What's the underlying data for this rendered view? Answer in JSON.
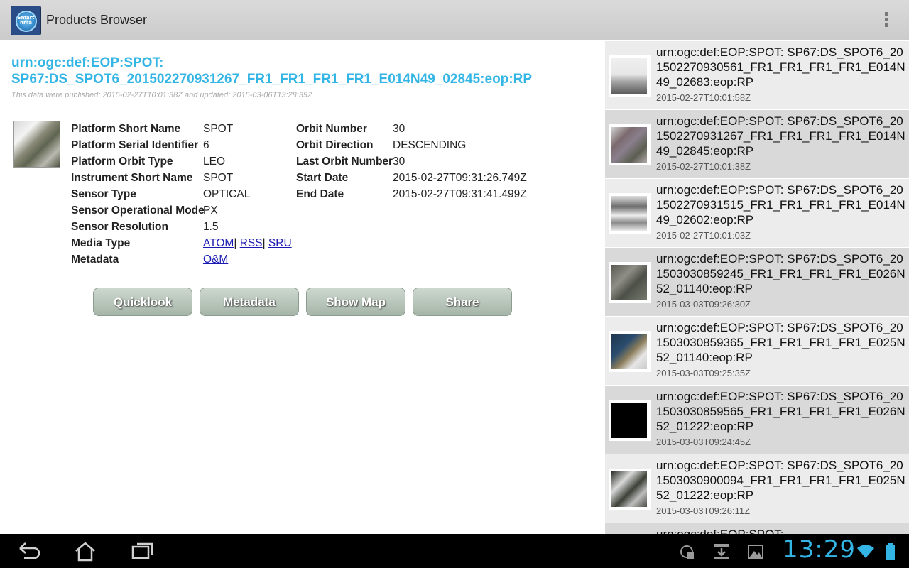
{
  "app": {
    "title": "Products Browser",
    "icon_text_1": "Smart",
    "icon_text_2": "hma",
    "menu_icon": "overflow-menu-icon"
  },
  "detail": {
    "title": "urn:ogc:def:EOP:SPOT: SP67:DS_SPOT6_201502270931267_FR1_FR1_FR1_FR1_E014N49_02845:eop:RP",
    "published": "This data were published: 2015-02-27T10:01:38Z and updated: 2015-03-06T13:28:39Z",
    "left_props": [
      {
        "label": "Platform Short Name",
        "value": "SPOT"
      },
      {
        "label": "Platform Serial Identifier",
        "value": "6"
      },
      {
        "label": "Platform Orbit Type",
        "value": "LEO"
      },
      {
        "label": "Instrument Short Name",
        "value": "SPOT"
      },
      {
        "label": "Sensor Type",
        "value": "OPTICAL"
      },
      {
        "label": "Sensor Operational Mode",
        "value": "PX"
      },
      {
        "label": "Sensor Resolution",
        "value": "1.5"
      },
      {
        "label": "Media Type",
        "value": ""
      },
      {
        "label": "Metadata",
        "value": ""
      }
    ],
    "media_links": {
      "atom": "ATOM",
      "sep1": "|",
      "rss": "RSS",
      "sep2": "|",
      "sru": "SRU"
    },
    "metadata_link": "O&M",
    "right_props": [
      {
        "label": "Orbit Number",
        "value": "30"
      },
      {
        "label": "Orbit Direction",
        "value": "DESCENDING"
      },
      {
        "label": "Last Orbit Number",
        "value": "30"
      },
      {
        "label": "Start Date",
        "value": "2015-02-27T09:31:26.749Z"
      },
      {
        "label": "End Date",
        "value": "2015-02-27T09:31:41.499Z"
      }
    ],
    "buttons": {
      "quicklook": "Quicklook",
      "metadata": "Metadata",
      "show_map": "Show Map",
      "share": "Share"
    }
  },
  "list": {
    "items": [
      {
        "text": "urn:ogc:def:EOP:SPOT: SP67:DS_SPOT6_201502270930561_FR1_FR1_FR1_FR1_E014N49_02683:eop:RP",
        "date": "2015-02-27T10:01:58Z"
      },
      {
        "text": "urn:ogc:def:EOP:SPOT: SP67:DS_SPOT6_201502270931267_FR1_FR1_FR1_FR1_E014N49_02845:eop:RP",
        "date": "2015-02-27T10:01:38Z"
      },
      {
        "text": "urn:ogc:def:EOP:SPOT: SP67:DS_SPOT6_201502270931515_FR1_FR1_FR1_FR1_E014N49_02602:eop:RP",
        "date": "2015-02-27T10:01:03Z"
      },
      {
        "text": "urn:ogc:def:EOP:SPOT: SP67:DS_SPOT6_201503030859245_FR1_FR1_FR1_FR1_E026N52_01140:eop:RP",
        "date": "2015-03-03T09:26:30Z"
      },
      {
        "text": "urn:ogc:def:EOP:SPOT: SP67:DS_SPOT6_201503030859365_FR1_FR1_FR1_FR1_E025N52_01140:eop:RP",
        "date": "2015-03-03T09:25:35Z"
      },
      {
        "text": "urn:ogc:def:EOP:SPOT: SP67:DS_SPOT6_201503030859565_FR1_FR1_FR1_FR1_E026N52_01222:eop:RP",
        "date": "2015-03-03T09:24:45Z"
      },
      {
        "text": "urn:ogc:def:EOP:SPOT: SP67:DS_SPOT6_201503030900094_FR1_FR1_FR1_FR1_E025N52_01222:eop:RP",
        "date": "2015-03-03T09:26:11Z"
      },
      {
        "text": "urn:ogc:def:EOP:SPOT:",
        "date": ""
      }
    ]
  },
  "statusbar": {
    "time": "13:29"
  },
  "colors": {
    "accent": "#33b5e5",
    "link": "#1a1ab3",
    "button_top": "#cdd8cf",
    "button_bottom": "#a6b5a9"
  }
}
